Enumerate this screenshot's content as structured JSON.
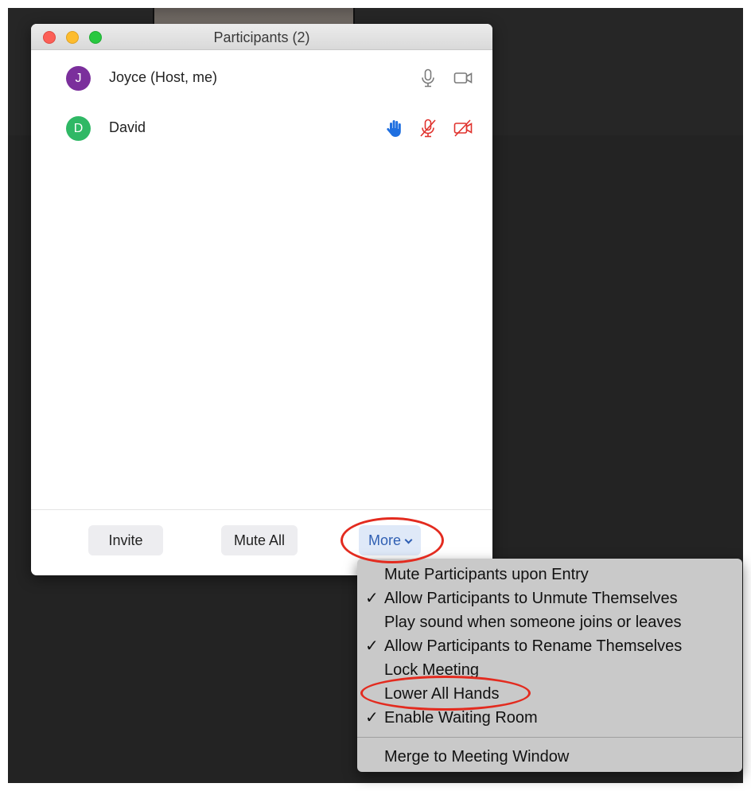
{
  "window": {
    "title": "Participants (2)"
  },
  "participants": [
    {
      "initial": "J",
      "name": "Joyce (Host, me)",
      "avatar_color": "#7b2f9c",
      "hand_raised": false,
      "mic": "on",
      "video": "on"
    },
    {
      "initial": "D",
      "name": "David",
      "avatar_color": "#2fb865",
      "hand_raised": true,
      "mic": "muted",
      "video": "off"
    }
  ],
  "footer": {
    "invite_label": "Invite",
    "mute_all_label": "Mute All",
    "more_label": "More"
  },
  "menu": {
    "items": [
      {
        "label": "Mute Participants upon Entry",
        "checked": false
      },
      {
        "label": "Allow Participants to Unmute Themselves",
        "checked": true
      },
      {
        "label": "Play sound when someone joins or leaves",
        "checked": false
      },
      {
        "label": "Allow Participants to Rename Themselves",
        "checked": true
      },
      {
        "label": "Lock Meeting",
        "checked": false
      },
      {
        "label": "Lower All Hands",
        "checked": false
      },
      {
        "label": "Enable Waiting Room",
        "checked": true
      },
      {
        "label": "Merge to Meeting Window",
        "checked": false
      }
    ],
    "check_glyph": "✓"
  },
  "colors": {
    "hand": "#1f6fe0",
    "muted": "#e0322d",
    "neutral_icon": "#7a7a7a",
    "annotation": "#e32b1f"
  }
}
